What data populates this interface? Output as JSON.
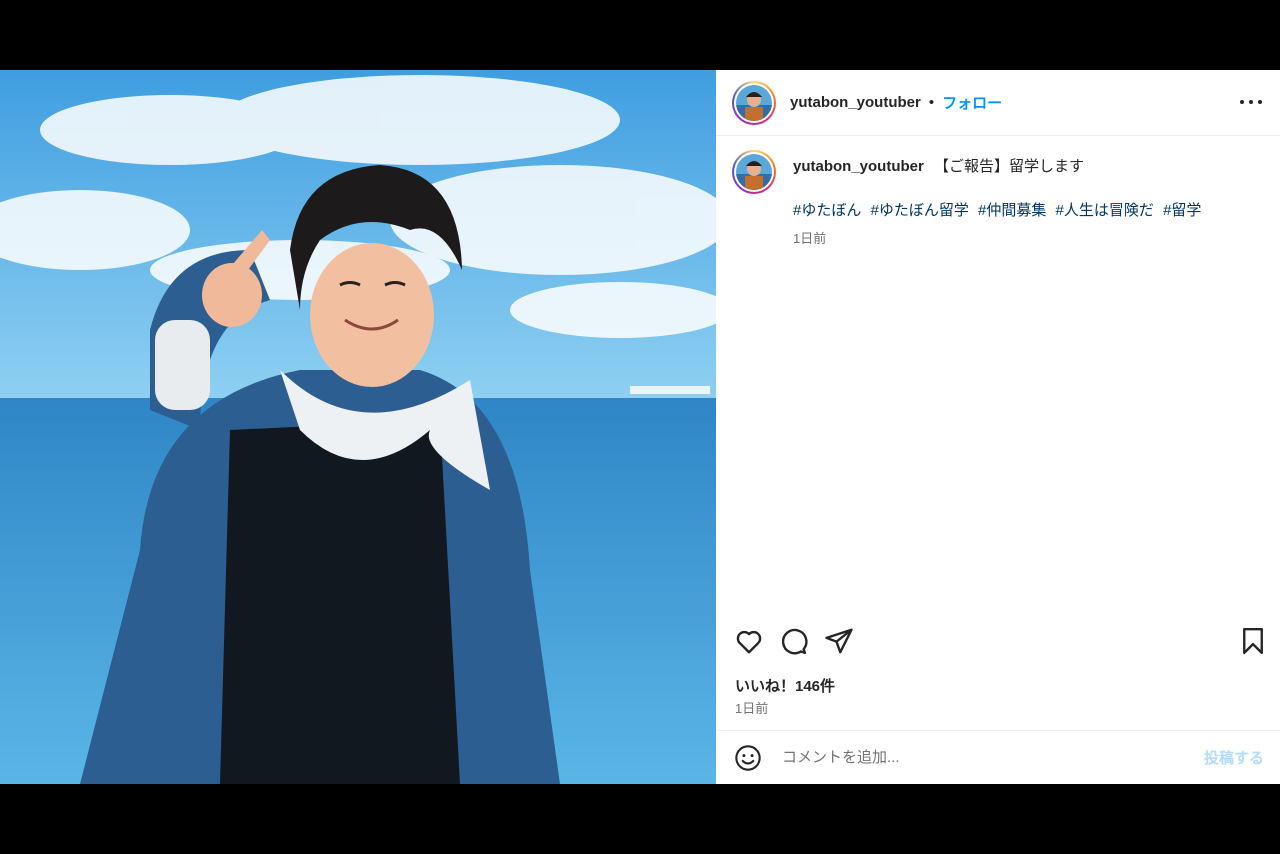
{
  "header": {
    "username": "yutabon_youtuber",
    "separator": "•",
    "follow_label": "フォロー"
  },
  "caption": {
    "username": "yutabon_youtuber",
    "text": "【ご報告】留学します",
    "hashtags": [
      "#ゆたぼん",
      "#ゆたぼん留学",
      "#仲間募集",
      "#人生は冒険だ",
      "#留学"
    ],
    "time": "1日前"
  },
  "actions": {
    "icons": [
      "heart-icon",
      "comment-icon",
      "share-icon",
      "bookmark-icon"
    ]
  },
  "likes": "いいね！146件",
  "posted_time": "1日前",
  "comment": {
    "placeholder": "コメントを追加...",
    "post_label": "投稿する"
  },
  "colors": {
    "follow": "#0095f6",
    "hashtag": "#00376b",
    "post_button_disabled": "#b3dbff"
  }
}
